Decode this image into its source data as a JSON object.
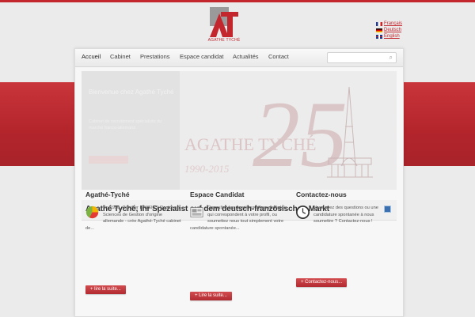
{
  "brand": {
    "name": "AGATHE TYCHÉ",
    "accent": "#c4262e"
  },
  "languages": [
    {
      "label": "Français"
    },
    {
      "label": "Deutsch"
    },
    {
      "label": "English"
    }
  ],
  "nav": {
    "items": [
      "Accueil",
      "Cabinet",
      "Prestations",
      "Espace candidat",
      "Actualités",
      "Contact"
    ],
    "active": "Accueil",
    "search_placeholder": ""
  },
  "slider": {
    "title": "Bienvenue chez Agathé Tyché",
    "text": "Cabinet de recrutement spécialiste du marché franco-allemand",
    "anniversary": "25",
    "wordmark": "AGATHE TYCHÉ",
    "years": "1990-2015"
  },
  "headline": "Agathé Tyché, Ihr Spezialist auf dem deutsch-französischen Markt",
  "columns": [
    {
      "title": "Agathé-Tyché",
      "icon": "pie-chart-icon",
      "text": "En 1990, Günther E.WEISS-Doctor en Sciences de Gestion d'origine allemande - crée Agathé-Tyché cabinet de...",
      "button": "+ lire la suite..."
    },
    {
      "title": "Espace Candidat",
      "icon": "newspaper-icon",
      "text": "Consultez les dernières offres d'emploi qui correspondent à votre profil, ou soumettez nous tout simplement votre candidature spontanée...",
      "button": "+ Lire la suite..."
    },
    {
      "title": "Contactez-nous",
      "icon": "clock-icon",
      "text": "Vous avez des questions ou une candidature spontanée à nous soumettre ? Contactez-nous !",
      "button": "+ Contactez-nous..."
    }
  ]
}
